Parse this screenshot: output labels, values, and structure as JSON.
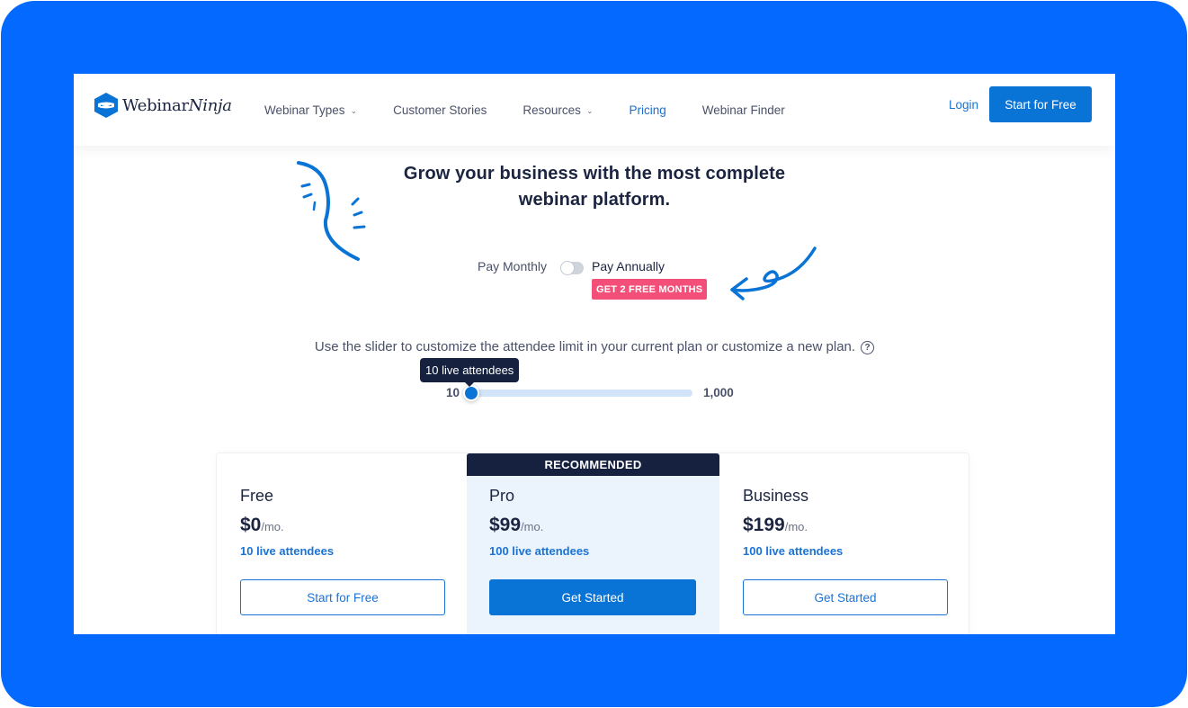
{
  "brand": {
    "name_regular": "Webinar",
    "name_italic": "Ninja",
    "accent_color": "#0a74d6",
    "frame_color": "#0469fe"
  },
  "nav": {
    "items": [
      {
        "label": "Webinar Types",
        "has_dropdown": true,
        "active": false
      },
      {
        "label": "Customer Stories",
        "has_dropdown": false,
        "active": false
      },
      {
        "label": "Resources",
        "has_dropdown": true,
        "active": false
      },
      {
        "label": "Pricing",
        "has_dropdown": false,
        "active": true
      },
      {
        "label": "Webinar Finder",
        "has_dropdown": false,
        "active": false
      }
    ],
    "dropdown_glyph": "⌄",
    "login_label": "Login",
    "cta_label": "Start for Free"
  },
  "hero": {
    "title_line1": "Grow your business with the most complete",
    "title_line2": "webinar platform."
  },
  "billing": {
    "monthly_label": "Pay Monthly",
    "annually_label": "Pay Annually",
    "toggle_state": "monthly",
    "promo_badge": "GET 2 FREE MONTHS",
    "promo_color": "#f34f79"
  },
  "slider": {
    "label": "Use the slider to customize the attendee limit in your current plan or customize a new plan.",
    "help_icon": "?",
    "min_label": "10",
    "max_label": "1,000",
    "min": 10,
    "max": 1000,
    "value": 10,
    "tooltip": "10 live attendees"
  },
  "plans": {
    "recommended_label": "RECOMMENDED",
    "per_label": "/mo.",
    "items": [
      {
        "name": "Free",
        "price": "$0",
        "attendees": "10 live attendees",
        "button": "Start for Free",
        "style": "outline"
      },
      {
        "name": "Pro",
        "price": "$99",
        "attendees": "100 live attendees",
        "button": "Get Started",
        "style": "solid",
        "recommended": true
      },
      {
        "name": "Business",
        "price": "$199",
        "attendees": "100 live attendees",
        "button": "Get Started",
        "style": "outline"
      }
    ]
  }
}
